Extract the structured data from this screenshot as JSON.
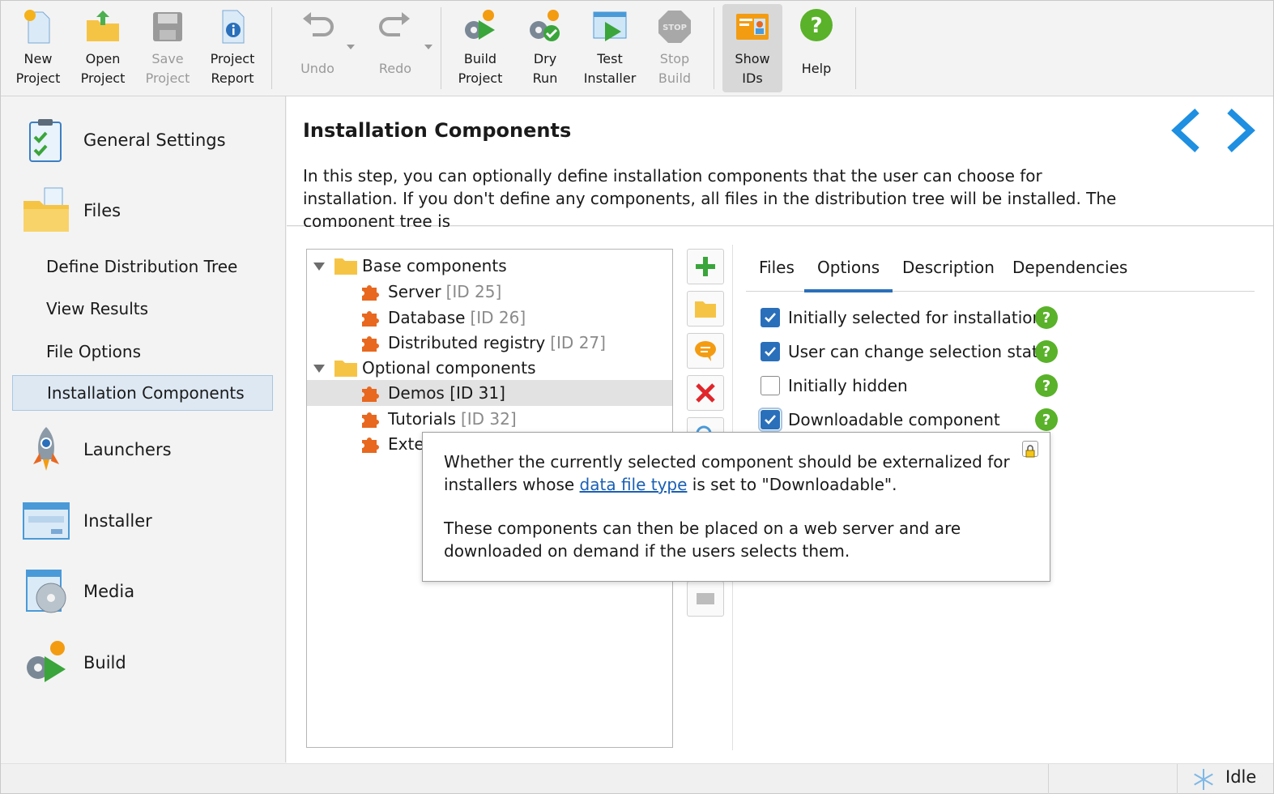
{
  "toolbar": {
    "new_project": "New\nProject",
    "open_project": "Open\nProject",
    "save_project": "Save\nProject",
    "project_report": "Project\nReport",
    "undo": "Undo",
    "redo": "Redo",
    "build_project": "Build\nProject",
    "dry_run": "Dry\nRun",
    "test_installer": "Test\nInstaller",
    "stop_build": "Stop\nBuild",
    "show_ids": "Show\nIDs",
    "help": "Help"
  },
  "sidebar": {
    "general_settings": "General Settings",
    "files": "Files",
    "define_distribution_tree": "Define Distribution Tree",
    "view_results": "View Results",
    "file_options": "File Options",
    "installation_components": "Installation Components",
    "launchers": "Launchers",
    "installer": "Installer",
    "media": "Media",
    "build": "Build"
  },
  "header": {
    "title": "Installation Components",
    "description": "In this step, you can optionally define installation components that the user can choose for installation. If you don't define any components, all files in the distribution tree will be installed. The component tree is"
  },
  "tree": {
    "base": "Base components",
    "server": "Server",
    "server_id": "[ID 25]",
    "database": "Database",
    "database_id": "[ID 26]",
    "registry": "Distributed registry",
    "registry_id": "[ID 27]",
    "optional": "Optional components",
    "demos": "Demos [ID 31]",
    "tutorials": "Tutorials",
    "tutorials_id": "[ID 32]",
    "external": "Exter"
  },
  "tabs": {
    "files": "Files",
    "options": "Options",
    "description": "Description",
    "dependencies": "Dependencies"
  },
  "options": {
    "initially_selected": "Initially selected for installation",
    "user_can_change": "User can change selection state",
    "initially_hidden": "Initially hidden",
    "downloadable": "Downloadable component"
  },
  "tooltip": {
    "line1_a": "Whether the currently selected component should be externalized for installers whose ",
    "link": "data file type",
    "line1_b": " is set to \"Downloadable\".",
    "line2": "These components can then be placed on a web server and are downloaded on demand if the users selects them."
  },
  "status": {
    "text": "Idle"
  },
  "colors": {
    "accent": "#2a6fba",
    "help_green": "#59b229",
    "puzzle_orange": "#e8681f",
    "folder_yellow": "#f6c445"
  }
}
